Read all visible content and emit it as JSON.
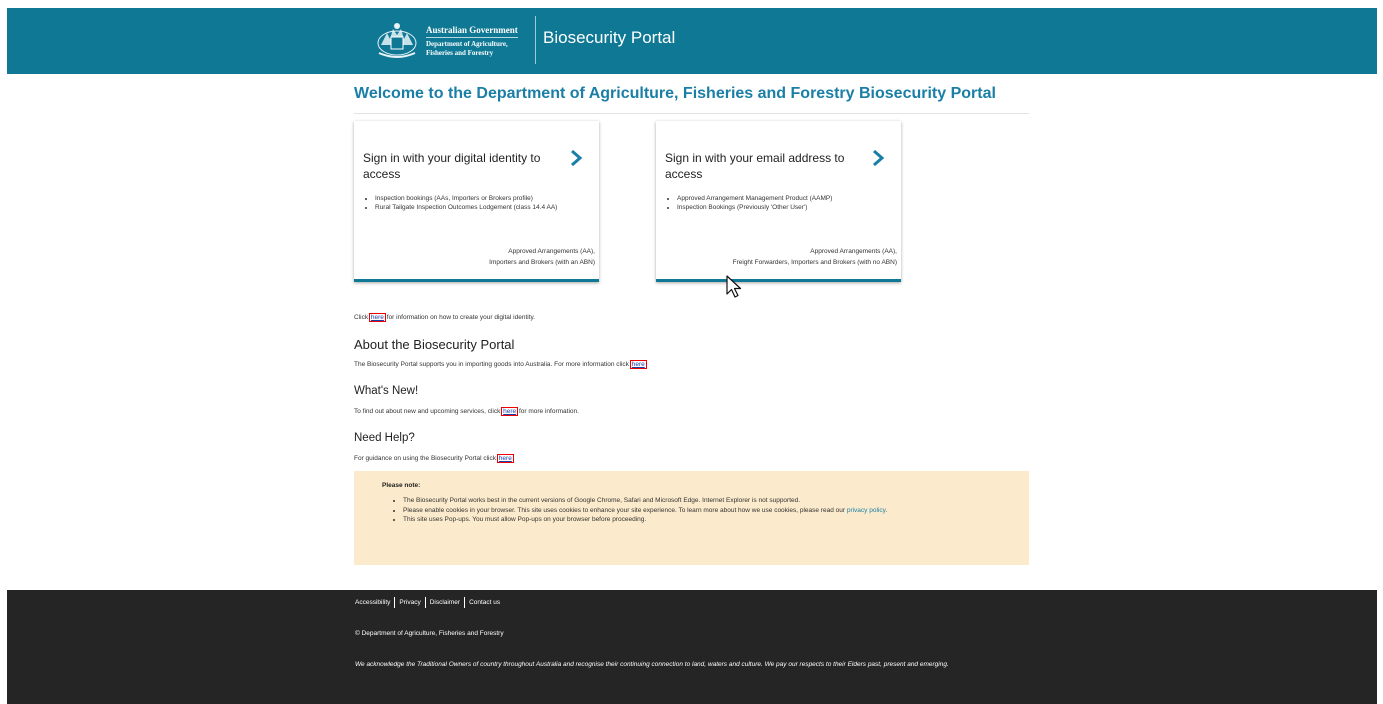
{
  "header": {
    "gov_line1": "Australian Government",
    "gov_line2": "Department of Agriculture,",
    "gov_line3": "Fisheries and Forestry",
    "portal_title": "Biosecurity Portal",
    "bg_color": "#0f7894"
  },
  "main": {
    "title": "Welcome to the Department of Agriculture, Fisheries and Forestry Biosecurity Portal",
    "cards": [
      {
        "title": "Sign in with your digital identity to access",
        "items": [
          "Inspection bookings (AAs, Importers or Brokers profile)",
          "Rural Tailgate Inspection Outcomes Lodgement (class 14.4 AA)"
        ],
        "footer_line1": "Approved Arrangements (AA),",
        "footer_line2": "Importers and Brokers (with an ABN)",
        "icon": "chevron-right-icon"
      },
      {
        "title": "Sign in with your email address to access",
        "items": [
          "Approved Arrangement Management Product (AAMP)",
          "Inspection Bookings (Previously 'Other User')"
        ],
        "footer_line1": "Approved Arrangements (AA),",
        "footer_line2": "Freight Forwarders, Importers and Brokers (with no ABN)",
        "icon": "chevron-right-icon"
      }
    ],
    "digital_identity": {
      "before": "Click ",
      "link": "here",
      "after": " for information on how to create your digital identity."
    },
    "about": {
      "heading": "About the Biosecurity Portal",
      "before": "The Biosecurity Portal supports you in importing goods into Australia. For more information click ",
      "link": "here"
    },
    "whats_new": {
      "heading": "What's New!",
      "before": "To find out about new and upcoming services, click ",
      "link": "here",
      "after": " for more information."
    },
    "help": {
      "heading": "Need Help?",
      "before": "For guidance on using the Biosecurity Portal click ",
      "link": "here"
    },
    "note": {
      "title": "Please note:",
      "item1": "The Biosecurity Portal works best in the current versions of Google Chrome, Safari and Microsoft Edge. Internet Explorer is not supported.",
      "item2_before": "Please enable cookies in your browser. This site uses cookies to enhance your site experience. To learn more about how we use cookies, please read our ",
      "item2_link": "privacy policy",
      "item2_after": ".",
      "item3": "This site uses Pop-ups. You must allow Pop-ups on your browser before proceeding.",
      "bg_color": "#fbeacb"
    }
  },
  "footer": {
    "links": [
      "Accessibility",
      "Privacy",
      "Disclaimer",
      "Contact us"
    ],
    "copyright": "© Department of Agriculture, Fisheries and Forestry",
    "acknowledgement": "We acknowledge the Traditional Owners of country throughout Australia and recognise their continuing connection to land, waters and culture. We pay our respects to their Elders past, present and emerging.",
    "bg_color": "#252525"
  }
}
